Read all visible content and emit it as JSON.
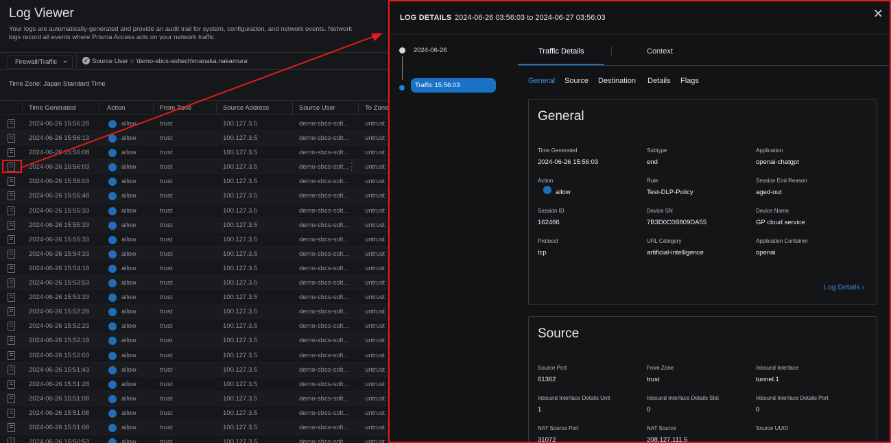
{
  "log_viewer": {
    "title": "Log Viewer",
    "description": "Your logs are automatically-generated and provide an audit trail for system, configuration, and network events. Network logs record all events where Prisma Access acts on your network traffic.",
    "dataset": "Firewall/Traffic",
    "query": "Source User = 'demo-sbcs-soltech\\manaka.nakamura'",
    "timezone": "Time Zone: Japan Standard Time",
    "columns": [
      "Time Generated",
      "Action",
      "From Zone",
      "Source Address",
      "Source User",
      "To Zone"
    ],
    "rows": [
      {
        "time": "2024-06-26 15:56:28",
        "action": "allow",
        "from_zone": "trust",
        "src": "100.127.3.5",
        "user": "demo-sbcs-solt...",
        "to_zone": "untrust"
      },
      {
        "time": "2024-06-26 15:56:13",
        "action": "allow",
        "from_zone": "trust",
        "src": "100.127.3.5",
        "user": "demo-sbcs-solt...",
        "to_zone": "untrust"
      },
      {
        "time": "2024-06-26 15:56:08",
        "action": "allow",
        "from_zone": "trust",
        "src": "100.127.3.5",
        "user": "demo-sbcs-solt...",
        "to_zone": "untrust"
      },
      {
        "time": "2024-06-26 15:56:03",
        "action": "allow",
        "from_zone": "trust",
        "src": "100.127.3.5",
        "user": "demo-sbcs-solt...",
        "to_zone": "untrust"
      },
      {
        "time": "2024-06-26 15:56:03",
        "action": "allow",
        "from_zone": "trust",
        "src": "100.127.3.5",
        "user": "demo-sbcs-solt...",
        "to_zone": "untrust"
      },
      {
        "time": "2024-06-26 15:55:48",
        "action": "allow",
        "from_zone": "trust",
        "src": "100.127.3.5",
        "user": "demo-sbcs-solt...",
        "to_zone": "untrust"
      },
      {
        "time": "2024-06-26 15:55:33",
        "action": "allow",
        "from_zone": "trust",
        "src": "100.127.3.5",
        "user": "demo-sbcs-solt...",
        "to_zone": "untrust"
      },
      {
        "time": "2024-06-26 15:55:33",
        "action": "allow",
        "from_zone": "trust",
        "src": "100.127.3.5",
        "user": "demo-sbcs-solt...",
        "to_zone": "untrust"
      },
      {
        "time": "2024-06-26 15:55:33",
        "action": "allow",
        "from_zone": "trust",
        "src": "100.127.3.5",
        "user": "demo-sbcs-solt...",
        "to_zone": "untrust"
      },
      {
        "time": "2024-06-26 15:54:33",
        "action": "allow",
        "from_zone": "trust",
        "src": "100.127.3.5",
        "user": "demo-sbcs-solt...",
        "to_zone": "untrust"
      },
      {
        "time": "2024-06-26 15:54:18",
        "action": "allow",
        "from_zone": "trust",
        "src": "100.127.3.5",
        "user": "demo-sbcs-solt...",
        "to_zone": "untrust"
      },
      {
        "time": "2024-06-26 15:53:53",
        "action": "allow",
        "from_zone": "trust",
        "src": "100.127.3.5",
        "user": "demo-sbcs-solt...",
        "to_zone": "untrust"
      },
      {
        "time": "2024-06-26 15:53:33",
        "action": "allow",
        "from_zone": "trust",
        "src": "100.127.3.5",
        "user": "demo-sbcs-solt...",
        "to_zone": "untrust"
      },
      {
        "time": "2024-06-26 15:52:28",
        "action": "allow",
        "from_zone": "trust",
        "src": "100.127.3.5",
        "user": "demo-sbcs-solt...",
        "to_zone": "untrust"
      },
      {
        "time": "2024-06-26 15:52:23",
        "action": "allow",
        "from_zone": "trust",
        "src": "100.127.3.5",
        "user": "demo-sbcs-solt...",
        "to_zone": "untrust"
      },
      {
        "time": "2024-06-26 15:52:18",
        "action": "allow",
        "from_zone": "trust",
        "src": "100.127.3.5",
        "user": "demo-sbcs-solt...",
        "to_zone": "untrust"
      },
      {
        "time": "2024-06-26 15:52:03",
        "action": "allow",
        "from_zone": "trust",
        "src": "100.127.3.5",
        "user": "demo-sbcs-solt...",
        "to_zone": "untrust"
      },
      {
        "time": "2024-06-26 15:51:43",
        "action": "allow",
        "from_zone": "trust",
        "src": "100.127.3.5",
        "user": "demo-sbcs-solt...",
        "to_zone": "untrust"
      },
      {
        "time": "2024-06-26 15:51:28",
        "action": "allow",
        "from_zone": "trust",
        "src": "100.127.3.5",
        "user": "demo-sbcs-solt...",
        "to_zone": "untrust"
      },
      {
        "time": "2024-06-26 15:51:08",
        "action": "allow",
        "from_zone": "trust",
        "src": "100.127.3.5",
        "user": "demo-sbcs-solt...",
        "to_zone": "untrust"
      },
      {
        "time": "2024-06-26 15:51:08",
        "action": "allow",
        "from_zone": "trust",
        "src": "100.127.3.5",
        "user": "demo-sbcs-solt...",
        "to_zone": "untrust"
      },
      {
        "time": "2024-06-26 15:51:08",
        "action": "allow",
        "from_zone": "trust",
        "src": "100.127.3.5",
        "user": "demo-sbcs-solt...",
        "to_zone": "untrust"
      },
      {
        "time": "2024-06-26 15:50:53",
        "action": "allow",
        "from_zone": "trust",
        "src": "100.127.3.5",
        "user": "demo-sbcs-solt...",
        "to_zone": "untrust"
      }
    ]
  },
  "details": {
    "title": "LOG DETAILS",
    "range": "2024-06-26 03:56:03 to 2024-06-27 03:56:03",
    "timeline_date": "2024-06-26",
    "timeline_entry": "Traffic 15:56:03",
    "tabs": [
      "Traffic Details",
      "Context"
    ],
    "subtabs": [
      "General",
      "Source",
      "Destination",
      "Details",
      "Flags"
    ],
    "general": {
      "title": "General",
      "fields": [
        {
          "label": "Time Generated",
          "value": "2024-06-26 15:56:03"
        },
        {
          "label": "Subtype",
          "value": "end"
        },
        {
          "label": "Application",
          "value": "openai-chatgpt"
        },
        {
          "label": "Action",
          "value": "allow"
        },
        {
          "label": "Rule",
          "value": "Test-DLP-Policy"
        },
        {
          "label": "Session End Reason",
          "value": "aged-out"
        },
        {
          "label": "Session ID",
          "value": "162466"
        },
        {
          "label": "Device SN",
          "value": "7B3D0C0B809DA55"
        },
        {
          "label": "Device Name",
          "value": "GP cloud service"
        },
        {
          "label": "Protocol",
          "value": "tcp"
        },
        {
          "label": "URL Category",
          "value": "artificial-intelligence"
        },
        {
          "label": "Application Container",
          "value": "openai"
        }
      ],
      "link": "Log Details ›"
    },
    "source": {
      "title": "Source",
      "fields": [
        {
          "label": "Source Port",
          "value": "61362"
        },
        {
          "label": "From Zone",
          "value": "trust"
        },
        {
          "label": "Inbound Interface",
          "value": "tunnel.1"
        },
        {
          "label": "Inbound Interface Details Unit",
          "value": "1"
        },
        {
          "label": "Inbound Interface Details Slot",
          "value": "0"
        },
        {
          "label": "Inbound Interface Details Port",
          "value": "0"
        },
        {
          "label": "NAT Source Port",
          "value": "31072"
        },
        {
          "label": "NAT Source",
          "value": "208.127.111.5"
        },
        {
          "label": "Source UUID",
          "value": ""
        }
      ]
    }
  },
  "icons": {
    "close": "close-icon",
    "chevron": "chevron-down-icon",
    "check": "check-circle-icon",
    "row_detail": "log-detail-icon",
    "action_dot": "allow-status-icon"
  },
  "colors": {
    "accent": "#1a72c6",
    "highlight": "#e51b1b",
    "allow": "#1f6fb8"
  }
}
